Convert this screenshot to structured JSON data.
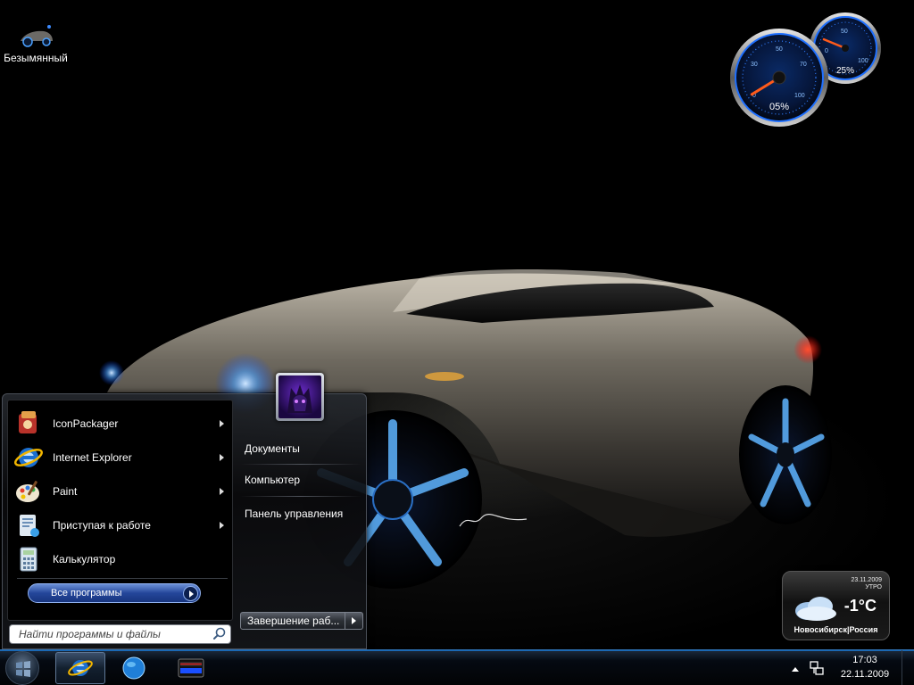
{
  "desktop": {
    "icons": [
      {
        "label": "Безымянный",
        "icon": "car-thumbnail-icon"
      }
    ],
    "wallpaper_signature": "V.A.M."
  },
  "gadgets": {
    "cpu_meter": {
      "large_gauge": {
        "value_label": "05%",
        "value": 5,
        "ticks": [
          "0",
          "30",
          "50",
          "70",
          "100"
        ]
      },
      "small_gauge": {
        "value_label": "25%",
        "value": 25,
        "ticks": [
          "0",
          "50",
          "100"
        ]
      }
    },
    "weather": {
      "date": "23.11.2009",
      "period": "УТРО",
      "temperature": "-1°C",
      "location": "Новосибирск|Россия",
      "icon": "cloud-icon"
    }
  },
  "start_menu": {
    "programs": [
      {
        "label": "IconPackager",
        "icon": "iconpackager-icon",
        "has_submenu": true
      },
      {
        "label": "Internet Explorer",
        "icon": "internet-explorer-icon",
        "has_submenu": true
      },
      {
        "label": "Paint",
        "icon": "paint-palette-icon",
        "has_submenu": true
      },
      {
        "label": "Приступая к работе",
        "icon": "getting-started-icon",
        "has_submenu": true
      },
      {
        "label": "Калькулятор",
        "icon": "calculator-icon",
        "has_submenu": false
      }
    ],
    "all_programs_label": "Все программы",
    "search_placeholder": "Найти программы и файлы",
    "right_links": [
      "Документы",
      "Компьютер",
      "Панель управления"
    ],
    "shutdown_label": "Завершение раб...",
    "user_picture_icon": "user-avatar-icon"
  },
  "taskbar": {
    "pinned": [
      "internet-explorer-icon",
      "globe-icon",
      "media-player-icon"
    ],
    "tray_icons": [
      "show-hidden-icons-arrow",
      "network-icon"
    ],
    "clock": {
      "time": "17:03",
      "date": "22.11.2009"
    }
  },
  "colors": {
    "accent_blue": "#1567b5",
    "gauge_blue": "#1e6fff",
    "needle_orange": "#ff5a1a",
    "all_programs_bg": "#24469a"
  }
}
